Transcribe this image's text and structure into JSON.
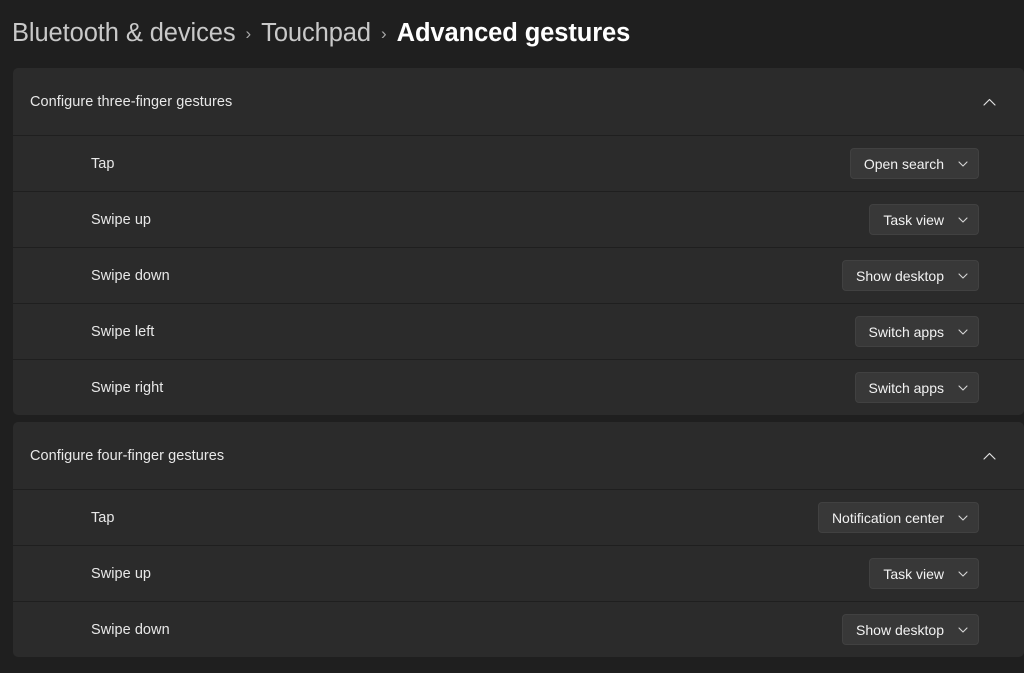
{
  "breadcrumb": {
    "items": [
      {
        "label": "Bluetooth & devices",
        "active": false
      },
      {
        "label": "Touchpad",
        "active": false
      },
      {
        "label": "Advanced gestures",
        "active": true
      }
    ],
    "separator": "›"
  },
  "colors": {
    "page_background": "#1f1f1f",
    "card_background": "#2b2b2b",
    "dropdown_background": "#383838",
    "text_primary": "#e8e8e8",
    "text_active": "#ffffff",
    "text_muted": "#c9c9c9"
  },
  "icons": {
    "collapse": "chevron-up-icon",
    "dropdown": "chevron-down-icon"
  },
  "sections": [
    {
      "title": "Configure three-finger gestures",
      "expanded": true,
      "rows": [
        {
          "label": "Tap",
          "value": "Open search"
        },
        {
          "label": "Swipe up",
          "value": "Task view"
        },
        {
          "label": "Swipe down",
          "value": "Show desktop"
        },
        {
          "label": "Swipe left",
          "value": "Switch apps"
        },
        {
          "label": "Swipe right",
          "value": "Switch apps"
        }
      ]
    },
    {
      "title": "Configure four-finger gestures",
      "expanded": true,
      "rows": [
        {
          "label": "Tap",
          "value": "Notification center"
        },
        {
          "label": "Swipe up",
          "value": "Task view"
        },
        {
          "label": "Swipe down",
          "value": "Show desktop"
        }
      ]
    }
  ]
}
